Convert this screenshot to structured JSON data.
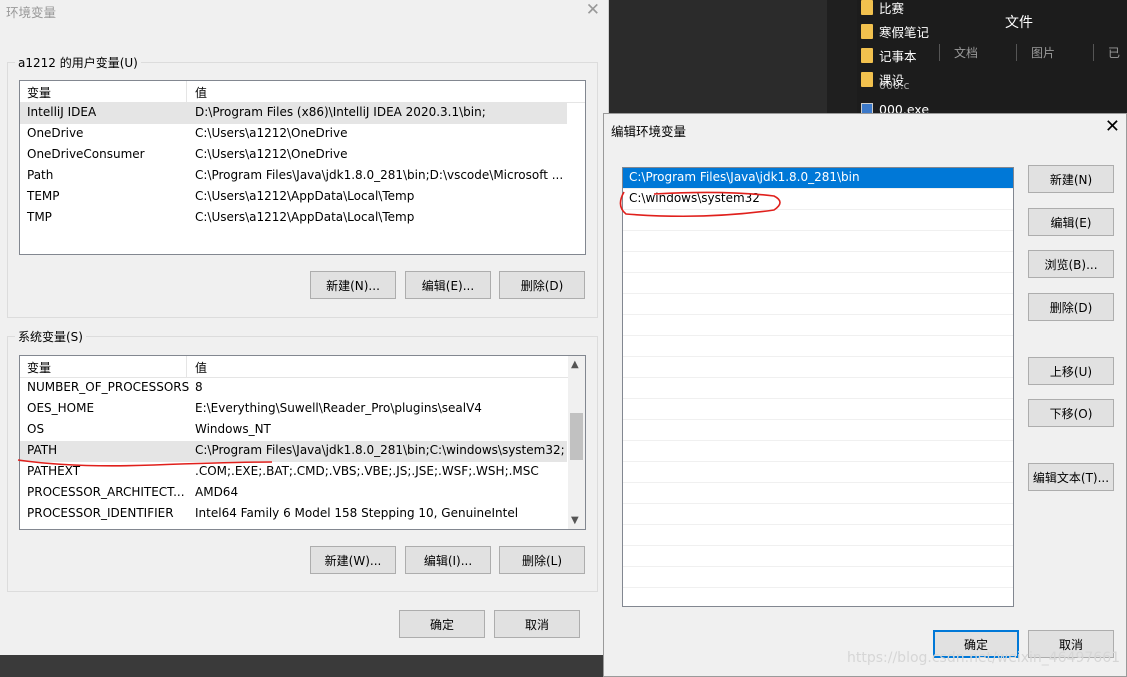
{
  "background": {
    "files": [
      {
        "name": "比赛",
        "icon": "folder-icon"
      },
      {
        "name": "寒假笔记",
        "icon": "folder-icon"
      },
      {
        "name": "记事本",
        "icon": "folder-icon"
      },
      {
        "name": "课设",
        "icon": "folder-icon"
      },
      {
        "name": "000.exe",
        "icon": "exe-icon"
      }
    ],
    "behind_text": "000.c",
    "panel_title": "文件",
    "tabs": [
      "文档",
      "图片",
      "已"
    ]
  },
  "main_dialog": {
    "title": "环境变量",
    "user_group": {
      "label": "a1212 的用户变量(U)",
      "headers": [
        "变量",
        "值"
      ],
      "rows": [
        {
          "name": "IntelliJ IDEA",
          "value": "D:\\Program Files (x86)\\IntelliJ IDEA 2020.3.1\\bin;"
        },
        {
          "name": "OneDrive",
          "value": "C:\\Users\\a1212\\OneDrive"
        },
        {
          "name": "OneDriveConsumer",
          "value": "C:\\Users\\a1212\\OneDrive"
        },
        {
          "name": "Path",
          "value": "C:\\Program Files\\Java\\jdk1.8.0_281\\bin;D:\\vscode\\Microsoft ..."
        },
        {
          "name": "TEMP",
          "value": "C:\\Users\\a1212\\AppData\\Local\\Temp"
        },
        {
          "name": "TMP",
          "value": "C:\\Users\\a1212\\AppData\\Local\\Temp"
        }
      ],
      "buttons": {
        "new": "新建(N)...",
        "edit": "编辑(E)...",
        "delete": "删除(D)"
      }
    },
    "system_group": {
      "label": "系统变量(S)",
      "headers": [
        "变量",
        "值"
      ],
      "rows": [
        {
          "name": "NUMBER_OF_PROCESSORS",
          "value": "8"
        },
        {
          "name": "OES_HOME",
          "value": "E:\\Everything\\Suwell\\Reader_Pro\\plugins\\sealV4"
        },
        {
          "name": "OS",
          "value": "Windows_NT"
        },
        {
          "name": "PATH",
          "value": "C:\\Program Files\\Java\\jdk1.8.0_281\\bin;C:\\windows\\system32;"
        },
        {
          "name": "PATHEXT",
          "value": ".COM;.EXE;.BAT;.CMD;.VBS;.VBE;.JS;.JSE;.WSF;.WSH;.MSC"
        },
        {
          "name": "PROCESSOR_ARCHITECT...",
          "value": "AMD64"
        },
        {
          "name": "PROCESSOR_IDENTIFIER",
          "value": "Intel64 Family 6 Model 158 Stepping 10, GenuineIntel"
        }
      ],
      "buttons": {
        "new": "新建(W)...",
        "edit": "编辑(I)...",
        "delete": "删除(L)"
      }
    },
    "ok": "确定",
    "cancel": "取消"
  },
  "edit_dialog": {
    "title": "编辑环境变量",
    "entries": [
      "C:\\Program Files\\Java\\jdk1.8.0_281\\bin",
      "C:\\windows\\system32"
    ],
    "buttons": {
      "new": "新建(N)",
      "edit": "编辑(E)",
      "browse": "浏览(B)...",
      "delete": "删除(D)",
      "up": "上移(U)",
      "down": "下移(O)",
      "edit_text": "编辑文本(T)..."
    },
    "ok": "确定",
    "cancel": "取消"
  },
  "watermark": "https://blog.csdn.net/weixin_46497661",
  "colors": {
    "accent": "#0078d7",
    "annotation": "#e0201c"
  }
}
